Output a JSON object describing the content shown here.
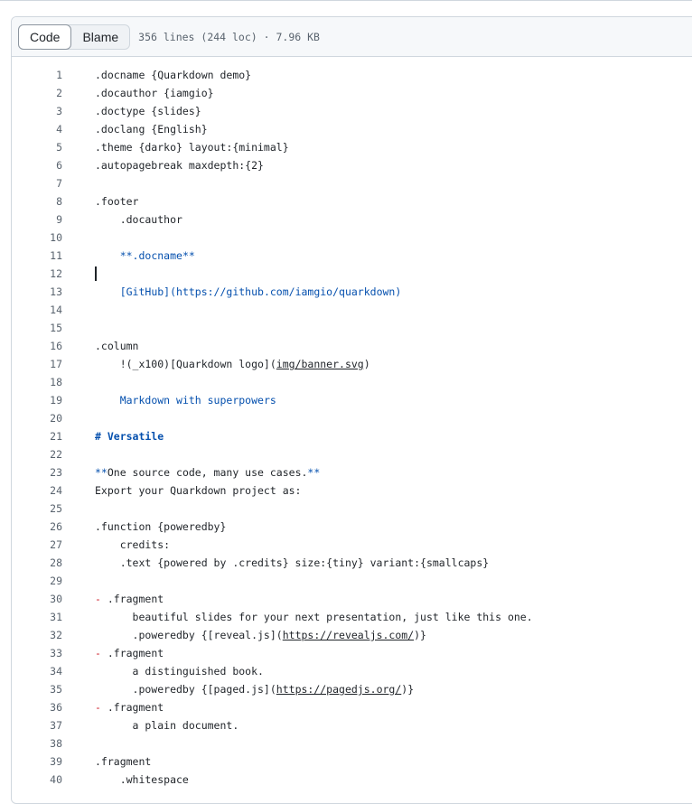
{
  "header": {
    "tabs": [
      {
        "label": "Code",
        "active": true
      },
      {
        "label": "Blame",
        "active": false
      }
    ],
    "file_info": "356 lines (244 loc) · 7.96 KB"
  },
  "colors": {
    "keyword": "#0550ae",
    "bullet": "#cf222e",
    "text": "#1f2328",
    "line_number": "#59636e"
  },
  "caret_line": 12,
  "lines": [
    {
      "n": "1",
      "tokens": [
        {
          "t": ".docname {Quarkdown demo}"
        }
      ]
    },
    {
      "n": "2",
      "tokens": [
        {
          "t": ".docauthor {iamgio}"
        }
      ]
    },
    {
      "n": "3",
      "tokens": [
        {
          "t": ".doctype {slides}"
        }
      ]
    },
    {
      "n": "4",
      "tokens": [
        {
          "t": ".doclang {English}"
        }
      ]
    },
    {
      "n": "5",
      "tokens": [
        {
          "t": ".theme {darko} layout:{minimal}"
        }
      ]
    },
    {
      "n": "6",
      "tokens": [
        {
          "t": ".autopagebreak maxdepth:{2}"
        }
      ]
    },
    {
      "n": "7",
      "tokens": []
    },
    {
      "n": "8",
      "tokens": [
        {
          "t": ".footer"
        }
      ]
    },
    {
      "n": "9",
      "tokens": [
        {
          "t": "    .docauthor"
        }
      ]
    },
    {
      "n": "10",
      "tokens": []
    },
    {
      "n": "11",
      "tokens": [
        {
          "t": "    "
        },
        {
          "t": "**.docname**",
          "c": "blue"
        }
      ]
    },
    {
      "n": "12",
      "tokens": []
    },
    {
      "n": "13",
      "tokens": [
        {
          "t": "    "
        },
        {
          "t": "[GitHub](https://github.com/iamgio/quarkdown)",
          "c": "blue"
        }
      ]
    },
    {
      "n": "14",
      "tokens": []
    },
    {
      "n": "15",
      "tokens": []
    },
    {
      "n": "16",
      "tokens": [
        {
          "t": ".column"
        }
      ]
    },
    {
      "n": "17",
      "tokens": [
        {
          "t": "    !(_x100)[Quarkdown logo]("
        },
        {
          "t": "img/banner.svg",
          "c": "link"
        },
        {
          "t": ")"
        }
      ]
    },
    {
      "n": "18",
      "tokens": []
    },
    {
      "n": "19",
      "tokens": [
        {
          "t": "    "
        },
        {
          "t": "Markdown with superpowers",
          "c": "blue"
        }
      ]
    },
    {
      "n": "20",
      "tokens": []
    },
    {
      "n": "21",
      "tokens": [
        {
          "t": "# Versatile",
          "c": "bold"
        }
      ]
    },
    {
      "n": "22",
      "tokens": []
    },
    {
      "n": "23",
      "tokens": [
        {
          "t": "**",
          "c": "blue"
        },
        {
          "t": "One source code, many use cases."
        },
        {
          "t": "**",
          "c": "blue"
        }
      ]
    },
    {
      "n": "24",
      "tokens": [
        {
          "t": "Export your Quarkdown project as:"
        }
      ]
    },
    {
      "n": "25",
      "tokens": []
    },
    {
      "n": "26",
      "tokens": [
        {
          "t": ".function {poweredby}"
        }
      ]
    },
    {
      "n": "27",
      "tokens": [
        {
          "t": "    credits:"
        }
      ]
    },
    {
      "n": "28",
      "tokens": [
        {
          "t": "    .text {powered by .credits} size:{tiny} variant:{smallcaps}"
        }
      ]
    },
    {
      "n": "29",
      "tokens": []
    },
    {
      "n": "30",
      "tokens": [
        {
          "t": "-",
          "c": "red"
        },
        {
          "t": " .fragment"
        }
      ]
    },
    {
      "n": "31",
      "tokens": [
        {
          "t": "      beautiful slides for your next presentation, just like this one."
        }
      ]
    },
    {
      "n": "32",
      "tokens": [
        {
          "t": "      .poweredby {[reveal.js]("
        },
        {
          "t": "https://revealjs.com/",
          "c": "link"
        },
        {
          "t": ")}"
        }
      ]
    },
    {
      "n": "33",
      "tokens": [
        {
          "t": "-",
          "c": "red"
        },
        {
          "t": " .fragment"
        }
      ]
    },
    {
      "n": "34",
      "tokens": [
        {
          "t": "      a distinguished book."
        }
      ]
    },
    {
      "n": "35",
      "tokens": [
        {
          "t": "      .poweredby {[paged.js]("
        },
        {
          "t": "https://pagedjs.org/",
          "c": "link"
        },
        {
          "t": ")}"
        }
      ]
    },
    {
      "n": "36",
      "tokens": [
        {
          "t": "-",
          "c": "red"
        },
        {
          "t": " .fragment"
        }
      ]
    },
    {
      "n": "37",
      "tokens": [
        {
          "t": "      a plain document."
        }
      ]
    },
    {
      "n": "38",
      "tokens": []
    },
    {
      "n": "39",
      "tokens": [
        {
          "t": ".fragment"
        }
      ]
    },
    {
      "n": "40",
      "tokens": [
        {
          "t": "    .whitespace"
        }
      ]
    }
  ]
}
